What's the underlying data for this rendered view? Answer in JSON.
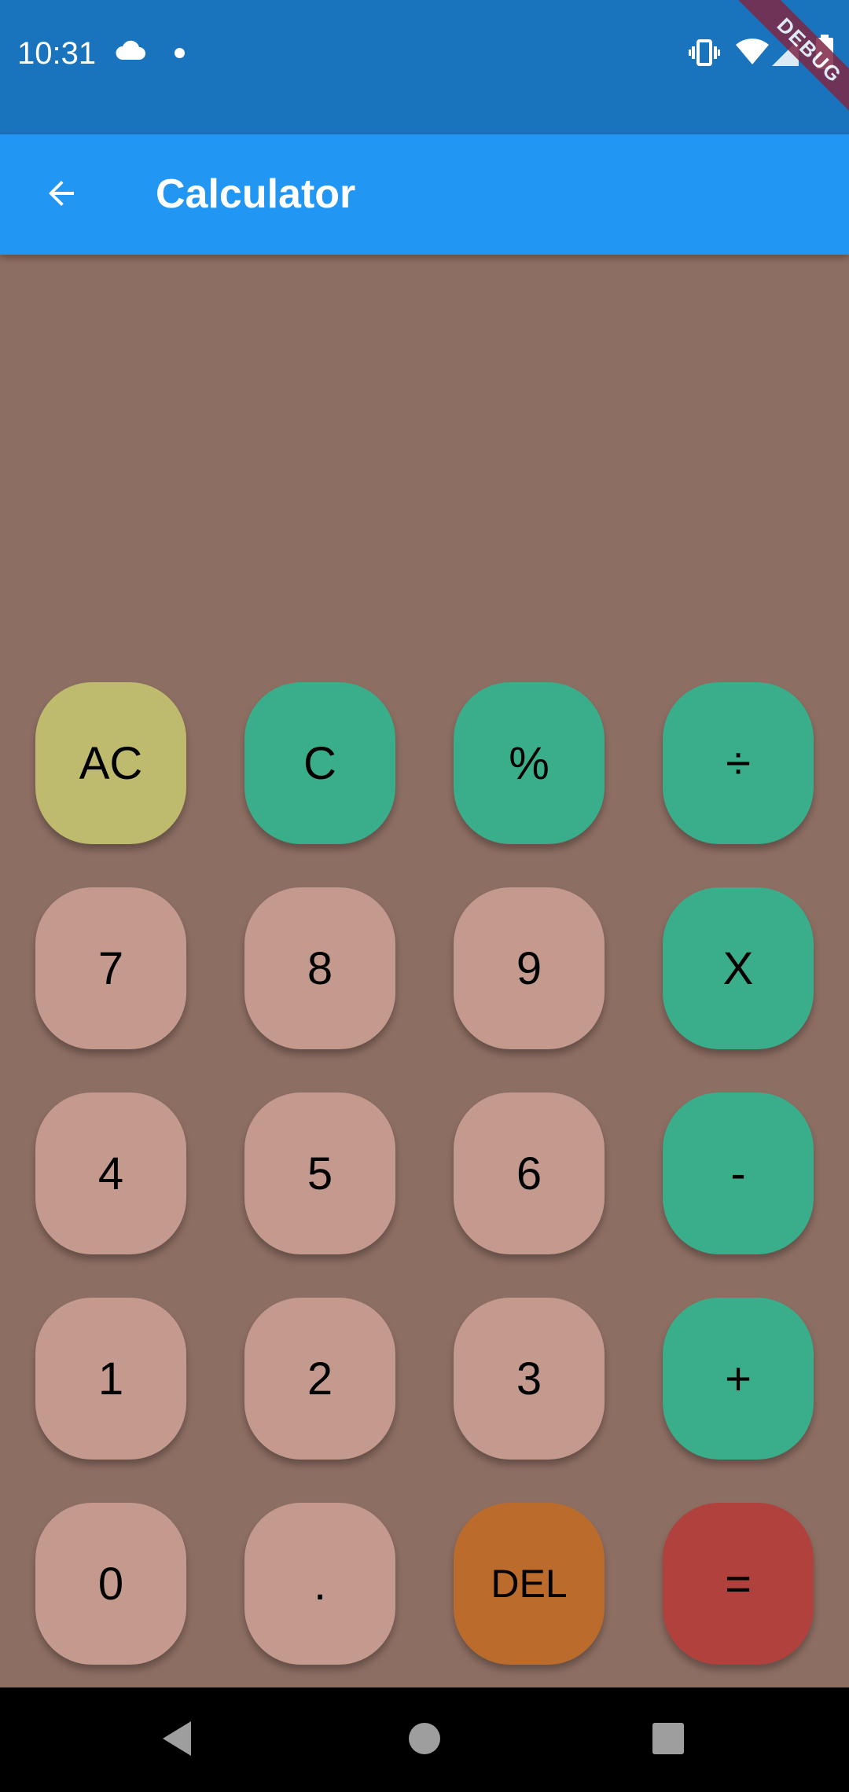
{
  "status_bar": {
    "time": "10:31",
    "left_icons": [
      "cloud-icon",
      "notification-dot-icon"
    ],
    "right_icons": [
      "vibrate-icon",
      "wifi-icon",
      "signal-icon",
      "battery-icon"
    ],
    "background_color": "#1a73bd"
  },
  "debug_banner": {
    "label": "DEBUG",
    "color": "#7e2846"
  },
  "app_bar": {
    "title": "Calculator",
    "back_icon": "back-arrow-icon",
    "background_color": "#2196f3"
  },
  "theme": {
    "background_color": "#8d6e63",
    "key_digit_color": "#c49a8f",
    "key_operator_color": "#3aad8b",
    "key_clear_all_color": "#bebb6f",
    "key_delete_color": "#bb6c2c",
    "key_equals_color": "#b1413d"
  },
  "keypad": {
    "rows": [
      [
        {
          "name": "key-ac",
          "label": "AC",
          "kind": "clear_all"
        },
        {
          "name": "key-c",
          "label": "C",
          "kind": "operator"
        },
        {
          "name": "key-percent",
          "label": "%",
          "kind": "operator"
        },
        {
          "name": "key-divide",
          "label": "÷",
          "kind": "operator"
        }
      ],
      [
        {
          "name": "key-7",
          "label": "7",
          "kind": "digit"
        },
        {
          "name": "key-8",
          "label": "8",
          "kind": "digit"
        },
        {
          "name": "key-9",
          "label": "9",
          "kind": "digit"
        },
        {
          "name": "key-multiply",
          "label": "X",
          "kind": "operator"
        }
      ],
      [
        {
          "name": "key-4",
          "label": "4",
          "kind": "digit"
        },
        {
          "name": "key-5",
          "label": "5",
          "kind": "digit"
        },
        {
          "name": "key-6",
          "label": "6",
          "kind": "digit"
        },
        {
          "name": "key-subtract",
          "label": "-",
          "kind": "operator"
        }
      ],
      [
        {
          "name": "key-1",
          "label": "1",
          "kind": "digit"
        },
        {
          "name": "key-2",
          "label": "2",
          "kind": "digit"
        },
        {
          "name": "key-3",
          "label": "3",
          "kind": "digit"
        },
        {
          "name": "key-add",
          "label": "+",
          "kind": "operator"
        }
      ],
      [
        {
          "name": "key-0",
          "label": "0",
          "kind": "digit"
        },
        {
          "name": "key-decimal",
          "label": ".",
          "kind": "digit"
        },
        {
          "name": "key-delete",
          "label": "DEL",
          "kind": "delete"
        },
        {
          "name": "key-equals",
          "label": "=",
          "kind": "equals"
        }
      ]
    ]
  },
  "nav_bar": {
    "buttons": [
      "nav-back-icon",
      "nav-home-icon",
      "nav-recents-icon"
    ]
  }
}
